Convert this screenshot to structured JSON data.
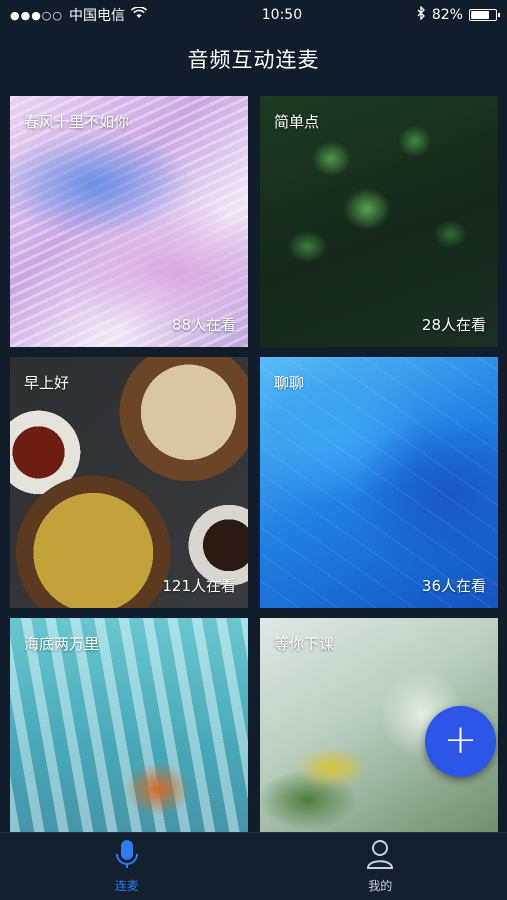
{
  "status_bar": {
    "carrier": "中国电信",
    "time": "10:50",
    "battery_percent": "82%",
    "battery_level": 0.82,
    "icons": [
      "signal-dots-icon",
      "wifi-icon",
      "bluetooth-icon",
      "battery-icon"
    ]
  },
  "nav": {
    "title": "音频互动连麦"
  },
  "rooms": [
    {
      "title": "春风十里不如你",
      "viewers": "88人在看"
    },
    {
      "title": "简单点",
      "viewers": "28人在看"
    },
    {
      "title": "早上好",
      "viewers": "121人在看"
    },
    {
      "title": "聊聊",
      "viewers": "36人在看"
    },
    {
      "title": "海底两万里",
      "viewers": ""
    },
    {
      "title": "等你下课",
      "viewers": ""
    }
  ],
  "fab": {
    "icon": "plus-icon",
    "label": "+"
  },
  "tabs": [
    {
      "label": "连麦",
      "icon": "microphone-icon",
      "active": true
    },
    {
      "label": "我的",
      "icon": "user-icon",
      "active": false
    }
  ],
  "colors": {
    "accent": "#2f7bf0",
    "background": "#111d2b",
    "fab": "#2b56e8"
  }
}
